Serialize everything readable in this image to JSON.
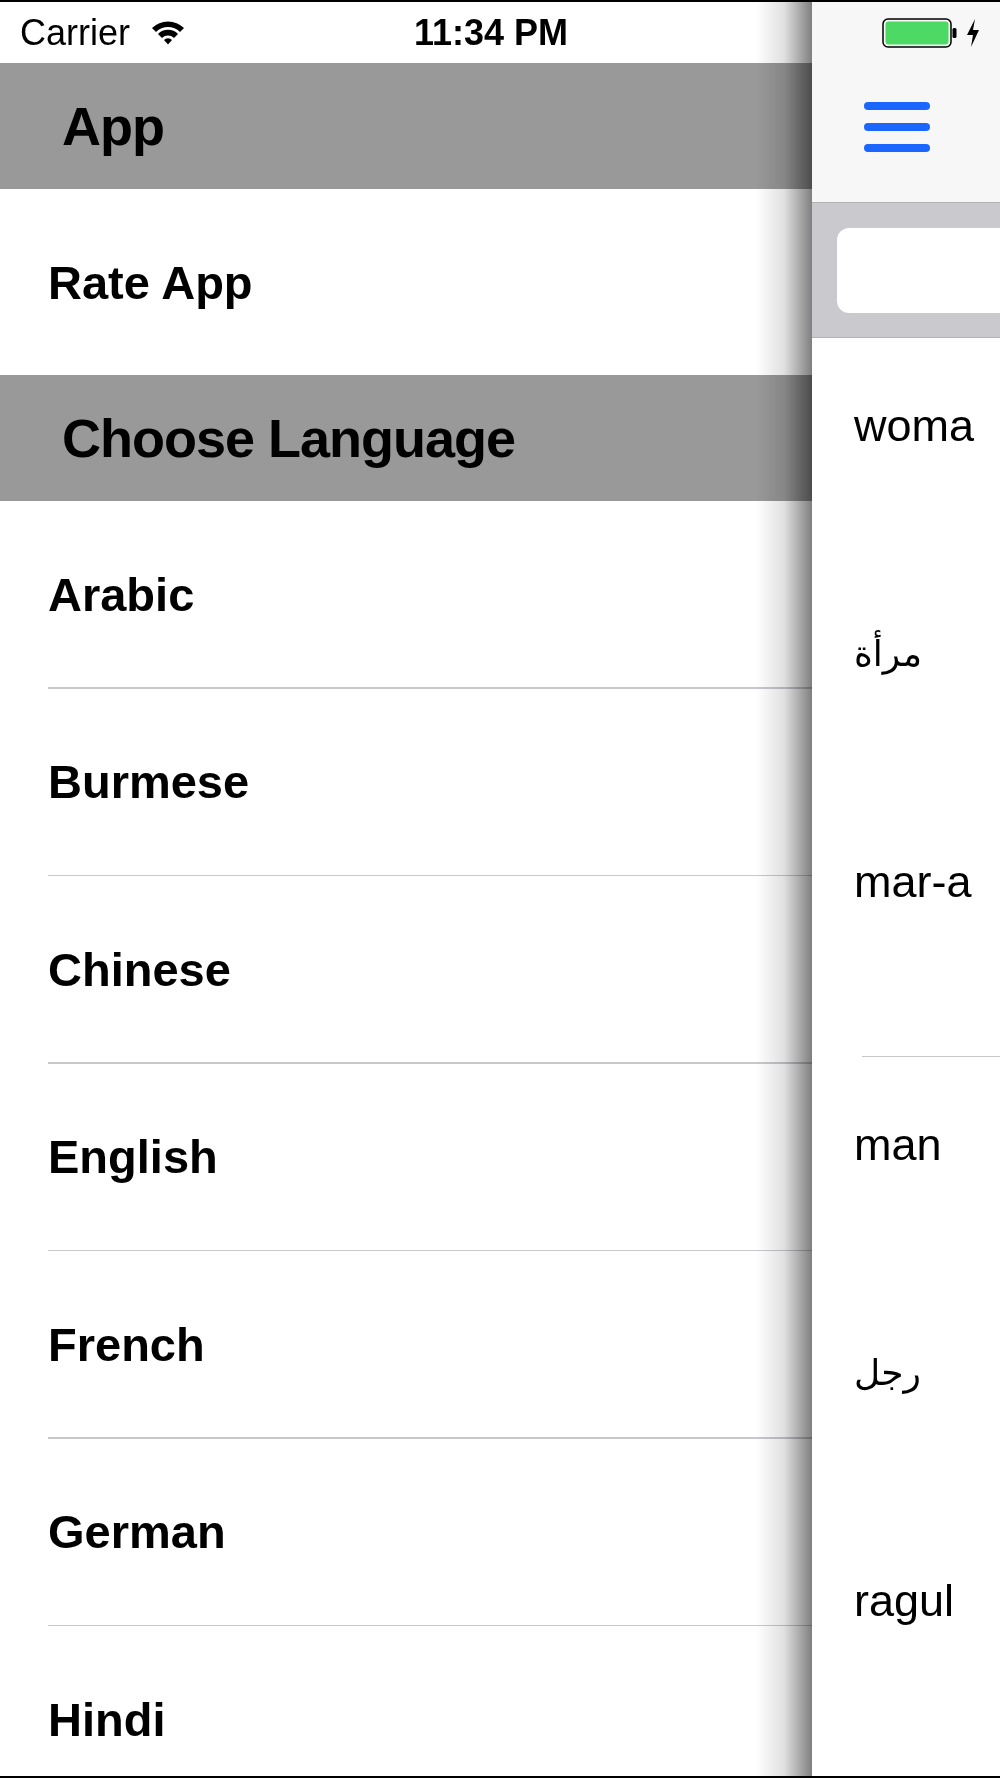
{
  "status_bar": {
    "carrier": "Carrier",
    "time": "11:34 PM",
    "charging": true
  },
  "menu": {
    "sections": [
      {
        "title": "App",
        "items": [
          {
            "label": "Rate App"
          }
        ]
      },
      {
        "title": "Choose Language",
        "items": [
          {
            "label": "Arabic"
          },
          {
            "label": "Burmese"
          },
          {
            "label": "Chinese"
          },
          {
            "label": "English"
          },
          {
            "label": "French"
          },
          {
            "label": "German"
          },
          {
            "label": "Hindi"
          }
        ]
      }
    ]
  },
  "entries": [
    {
      "word": "woma",
      "arabic": "مرأة",
      "transliteration": "mar-a"
    },
    {
      "word": "man",
      "arabic": "رجل",
      "transliteration": "ragul"
    }
  ]
}
